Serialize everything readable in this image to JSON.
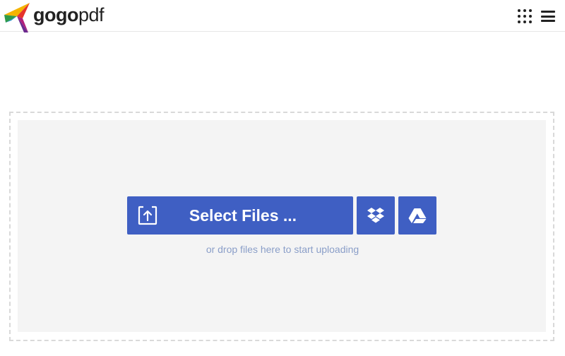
{
  "header": {
    "logo": {
      "bold_part": "gogo",
      "light_part": "pdf",
      "icon": "gogopdf-logo-icon"
    },
    "apps_icon": "grid-apps-icon",
    "menu_icon": "hamburger-menu-icon"
  },
  "upload": {
    "select_label": "Select Files ...",
    "select_icon": "upload-icon",
    "dropbox_icon": "dropbox-icon",
    "drive_icon": "google-drive-icon",
    "hint": "or drop files here to start uploading"
  },
  "colors": {
    "button": "#3f5fc3",
    "hint": "#8a9ec8",
    "dropzone_bg": "#f4f4f4",
    "dashed_border": "#d9d9d9"
  }
}
